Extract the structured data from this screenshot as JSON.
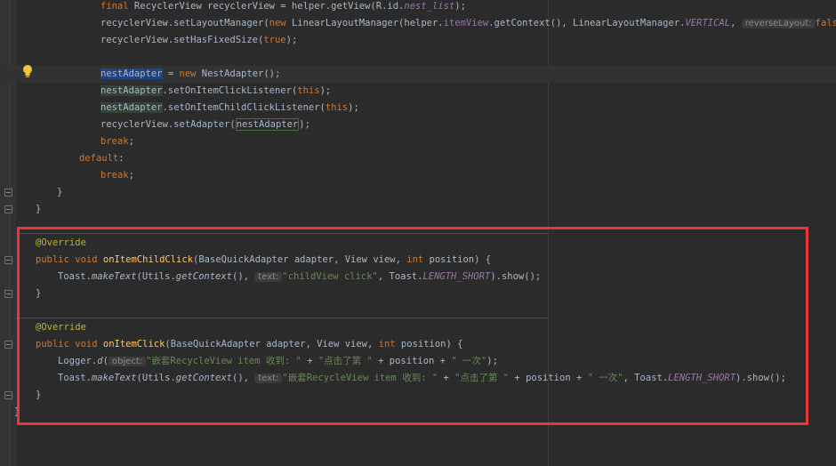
{
  "editor": {
    "language": "java",
    "annotation_color": "#e8363a",
    "lines": {
      "l1": {
        "kw": "final",
        "t1": " RecyclerView recyclerView = helper.getView(R.id.",
        "fld": "nest_list",
        "t2": ");"
      },
      "l2": {
        "t1": "recyclerView.setLayoutManager(",
        "kw": "new",
        "t2": " LinearLayoutManager(helper.",
        "fld": "itemView",
        "t3": ".getContext(), LinearLayoutManager.",
        "fld2": "VERTICAL",
        "t4": ", ",
        "hint": "reverseLayout:",
        "kw2": "false",
        "t5": "));"
      },
      "l3": {
        "t1": "recyclerView.setHasFixedSize(",
        "kw": "true",
        "t2": ");"
      },
      "l4": {
        "sel": "nestAdapter",
        "t1": " = ",
        "kw": "new",
        "t2": " NestAdapter();"
      },
      "l5": {
        "sel": "nestAdapter",
        "t1": ".setOnItemClickListener(",
        "kw": "this",
        "t2": ");"
      },
      "l6": {
        "sel": "nestAdapter",
        "t1": ".setOnItemChildClickListener(",
        "kw": "this",
        "t2": ");"
      },
      "l7": {
        "t1": "recyclerView.setAdapter(",
        "sel": "nestAdapter",
        "t2": ");"
      },
      "l8": {
        "kw": "break",
        "t1": ";"
      },
      "l9": {
        "kw": "default",
        "t1": ":"
      },
      "l10": {
        "kw": "break",
        "t1": ";"
      },
      "l11": {
        "t1": "}"
      },
      "l12": {
        "t1": "}"
      },
      "l13": {
        "ann": "@Override"
      },
      "l14": {
        "kw": "public void",
        "t0": " ",
        "mtd": "onItemChildClick",
        "t1": "(BaseQuickAdapter adapter, View view, ",
        "kw2": "int",
        "t2": " position) {"
      },
      "l15": {
        "t1": "Toast.",
        "it1": "makeText",
        "t2": "(Utils.",
        "it2": "getContext",
        "t3": "(), ",
        "hint": "text:",
        "str": "\"childView click\"",
        "t4": ", Toast.",
        "fld": "LENGTH_SHORT",
        "t5": ").show();"
      },
      "l16": {
        "t1": "}"
      },
      "l17": {
        "ann": "@Override"
      },
      "l18": {
        "kw": "public void",
        "t0": " ",
        "mtd": "onItemClick",
        "t1": "(BaseQuickAdapter adapter, View view, ",
        "kw2": "int",
        "t2": " position) {"
      },
      "l19": {
        "t1": "Logger.",
        "it1": "d",
        "t2": "(",
        "hint": "object:",
        "str": "\"嵌套RecycleView item 收到: \"",
        "t3": " + ",
        "str2": "\"点击了第 \"",
        "t4": " + position + ",
        "str3": "\" 一次\"",
        "t5": ");"
      },
      "l20": {
        "t1": "Toast.",
        "it1": "makeText",
        "t2": "(Utils.",
        "it2": "getContext",
        "t3": "(), ",
        "hint": "text:",
        "str": "\"嵌套RecycleView item 收到: \"",
        "t4": " + ",
        "str2": "\"点击了第 \"",
        "t5": " + position + ",
        "str3": "\" 一次\"",
        "t6": ", Toast.",
        "fld": "LENGTH_SHORT",
        "t7": ").show();"
      },
      "l21": {
        "t1": "}"
      },
      "l22": {
        "t1": "}"
      }
    }
  }
}
